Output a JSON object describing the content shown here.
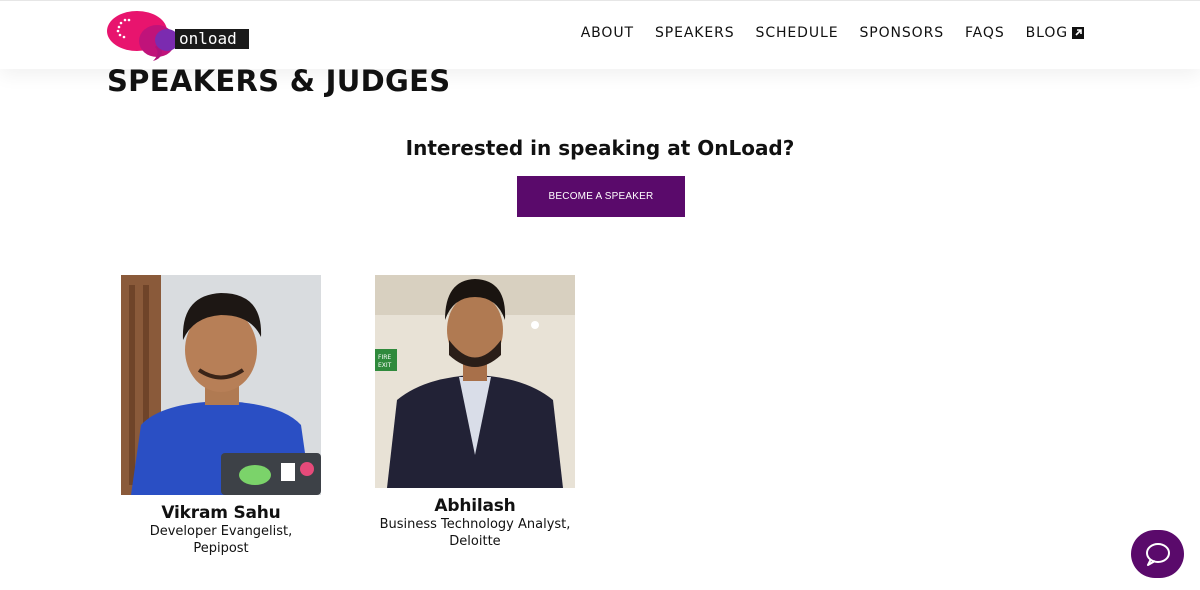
{
  "header": {
    "logo_text": "onload",
    "nav": [
      {
        "label": "ABOUT"
      },
      {
        "label": "SPEAKERS"
      },
      {
        "label": "SCHEDULE"
      },
      {
        "label": "SPONSORS"
      },
      {
        "label": "FAQS"
      },
      {
        "label": "BLOG",
        "icon": "external-link-icon"
      }
    ]
  },
  "page": {
    "title": "SPEAKERS & JUDGES",
    "cta_heading": "Interested in speaking at OnLoad?",
    "cta_button": "BECOME A SPEAKER"
  },
  "speakers": [
    {
      "name": "Vikram Sahu",
      "role": "Developer Evangelist,",
      "company": "Pepipost"
    },
    {
      "name": "Abhilash",
      "role": "Business Technology Analyst,",
      "company": "Deloitte"
    }
  ],
  "chat": {
    "icon": "chat-bubble-icon"
  },
  "colors": {
    "accent": "#5a0a6b",
    "logo_pink": "#e8146e",
    "logo_purple": "#7b1fa2"
  }
}
